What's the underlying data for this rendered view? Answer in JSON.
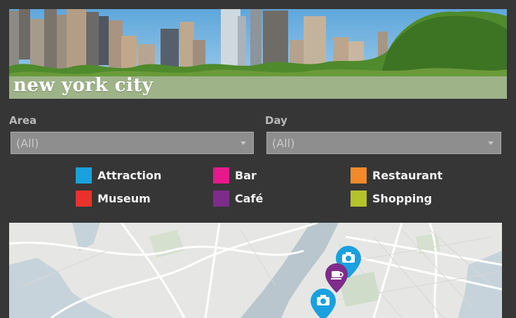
{
  "banner": {
    "title": "new york city"
  },
  "filters": {
    "area": {
      "label": "Area",
      "value": "(All)"
    },
    "day": {
      "label": "Day",
      "value": "(All)"
    }
  },
  "legend": [
    {
      "label": "Attraction",
      "color": "#1aa0df"
    },
    {
      "label": "Bar",
      "color": "#e6198c"
    },
    {
      "label": "Restaurant",
      "color": "#f08a2a"
    },
    {
      "label": "Museum",
      "color": "#e8322b"
    },
    {
      "label": "Café",
      "color": "#7d2c8a"
    },
    {
      "label": "Shopping",
      "color": "#b5c32a"
    }
  ],
  "map": {
    "pins": [
      {
        "category": "Attraction",
        "icon": "camera-icon"
      },
      {
        "category": "Café",
        "icon": "coffee-cup-icon"
      },
      {
        "category": "Attraction",
        "icon": "camera-icon"
      }
    ]
  }
}
